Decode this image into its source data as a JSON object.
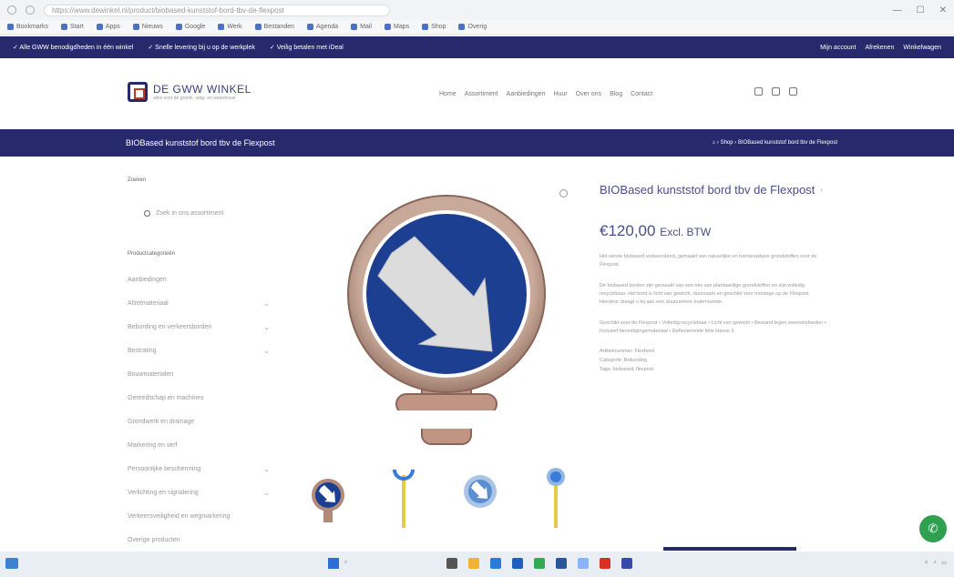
{
  "browser": {
    "url": "https://www.dewinkel.nl/product/biobased-kunststof-bord-tbv-de-flexpost",
    "bookmarks": [
      "Bookmarks",
      "Start",
      "Apps",
      "Nieuws",
      "Google",
      "Werk",
      "Bestanden",
      "Agenda",
      "Mail",
      "Maps",
      "Shop",
      "Overig"
    ]
  },
  "topbar": {
    "items": [
      "✓ Alle GWW benodigdheden in één winkel",
      "✓ Snelle levering bij u op de werkplek",
      "✓ Veilig betalen met iDeal"
    ],
    "right_items": [
      "Mijn account",
      "Afrekenen",
      "Winkelwagen"
    ]
  },
  "header": {
    "logo_name": "DE GWW WINKEL",
    "logo_sub": "alles voor de grond-, weg- en waterbouw",
    "nav": [
      "Home",
      "Assortiment",
      "Aanbiedingen",
      "Huur",
      "Over ons",
      "Blog",
      "Contact"
    ]
  },
  "title_bar": {
    "page_title": "BIOBased kunststof bord tbv de Flexpost",
    "breadcrumb": "⌂ › Shop › BIOBased kunststof bord tbv de Flexpost"
  },
  "sidebar": {
    "search_heading": "Zoeken",
    "search_placeholder": "Zoek in ons assortiment",
    "categories_heading": "Productcategorieën",
    "categories": [
      {
        "label": "Aanbiedingen",
        "expandable": false
      },
      {
        "label": "Afzetmateriaal",
        "expandable": true
      },
      {
        "label": "Bebording en verkeersborden",
        "expandable": true
      },
      {
        "label": "Bestrating",
        "expandable": true
      },
      {
        "label": "Bouwmaterialen",
        "expandable": false
      },
      {
        "label": "Gereedschap en machines",
        "expandable": false
      },
      {
        "label": "Grondwerk en drainage",
        "expandable": false
      },
      {
        "label": "Markering en verf",
        "expandable": false
      },
      {
        "label": "Persoonlijke bescherming",
        "expandable": true
      },
      {
        "label": "Verlichting en signalering",
        "expandable": true
      },
      {
        "label": "Verkeersveiligheid en wegmarkering",
        "expandable": false
      },
      {
        "label": "Overige producten",
        "expandable": false
      }
    ]
  },
  "product": {
    "title": "BIOBased kunststof bord tbv de Flexpost",
    "price": "€120,00",
    "price_suffix": "Excl. BTW",
    "intro": "Het eerste biobased verkeersbord, gemaakt van natuurlijke en hernieuwbare grondstoffen voor de Flexpost.",
    "description": "De biobased borden zijn gemaakt van een mix van plantaardige grondstoffen en zijn volledig recyclebaar. Het bord is licht van gewicht, duurzaam en geschikt voor montage op de Flexpost. Hierdoor draagt u bij aan een duurzamere buitenruimte.",
    "features": "Geschikt voor de Flexpost • Volledig recyclebaar • Licht van gewicht • Bestand tegen weersinvloeden • Inclusief bevestigingsmateriaal • Reflecterende folie klasse 3",
    "meta": [
      "Artikelnummer: Flexbord",
      "Categorie: Bebording",
      "Tags: biobased, flexpost"
    ]
  },
  "colors": {
    "brand": "#262a6d",
    "sign_blue": "#1d3f91",
    "post_yellow": "#e6c94a",
    "fab_green": "#2ea04f"
  }
}
